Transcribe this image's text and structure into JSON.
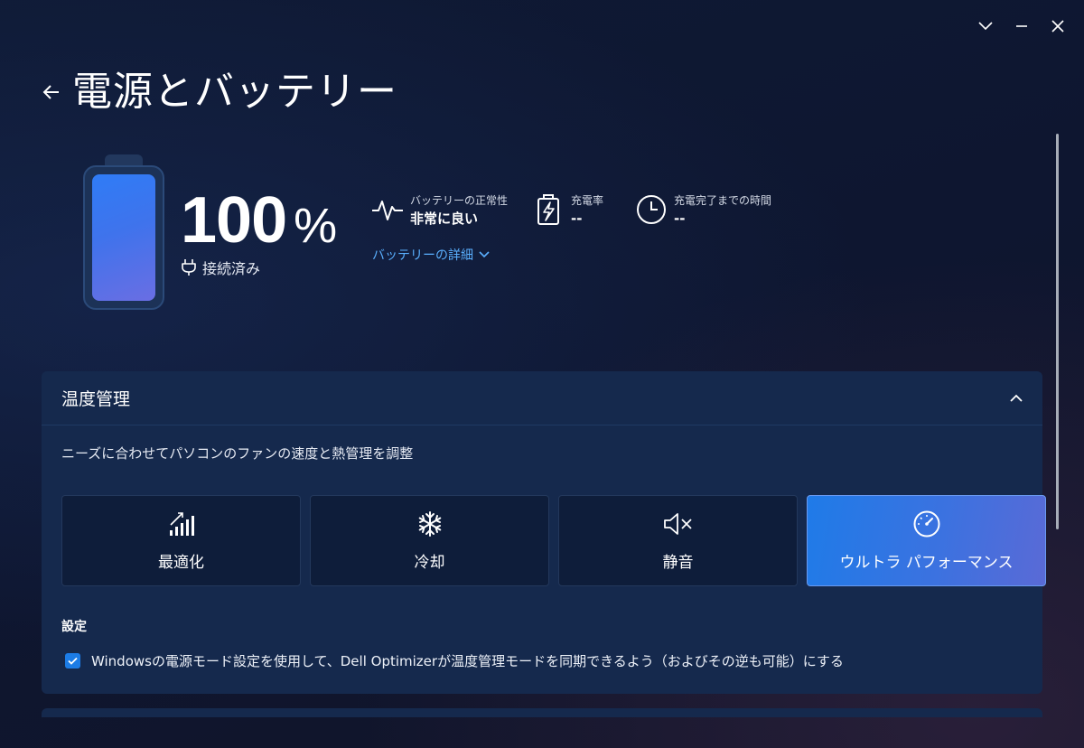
{
  "window": {
    "controls": [
      "chevron-down",
      "minimize",
      "close"
    ]
  },
  "header": {
    "title": "電源とバッテリー"
  },
  "battery": {
    "level_fraction": 1.0,
    "percent_number": "100",
    "percent_sign": "%",
    "plug_status": "接続済み"
  },
  "stats": {
    "health_label": "バッテリーの正常性",
    "health_value": "非常に良い",
    "charge_rate_label": "充電率",
    "charge_rate_value": "--",
    "time_to_full_label": "充電完了までの時間",
    "time_to_full_value": "--",
    "details_link": "バッテリーの詳細"
  },
  "thermal": {
    "title": "温度管理",
    "description": "ニーズに合わせてパソコンのファンの速度と熱管理を調整",
    "modes": [
      {
        "label": "最適化",
        "icon": "signal-bars-icon",
        "selected": false
      },
      {
        "label": "冷却",
        "icon": "snowflake-icon",
        "selected": false
      },
      {
        "label": "静音",
        "icon": "speaker-mute-icon",
        "selected": false
      },
      {
        "label": "ウルトラ パフォーマンス",
        "icon": "speedometer-icon",
        "selected": true
      }
    ],
    "settings_title": "設定",
    "sync_setting_label": "Windowsの電源モード設定を使用して、Dell Optimizerが温度管理モードを同期できるよう（およびその逆も可能）にする",
    "sync_setting_checked": true
  },
  "colors": {
    "accent": "#1c7ce6",
    "link": "#5ab0ff",
    "panel": "#15294d",
    "background": "#0f1a35"
  }
}
